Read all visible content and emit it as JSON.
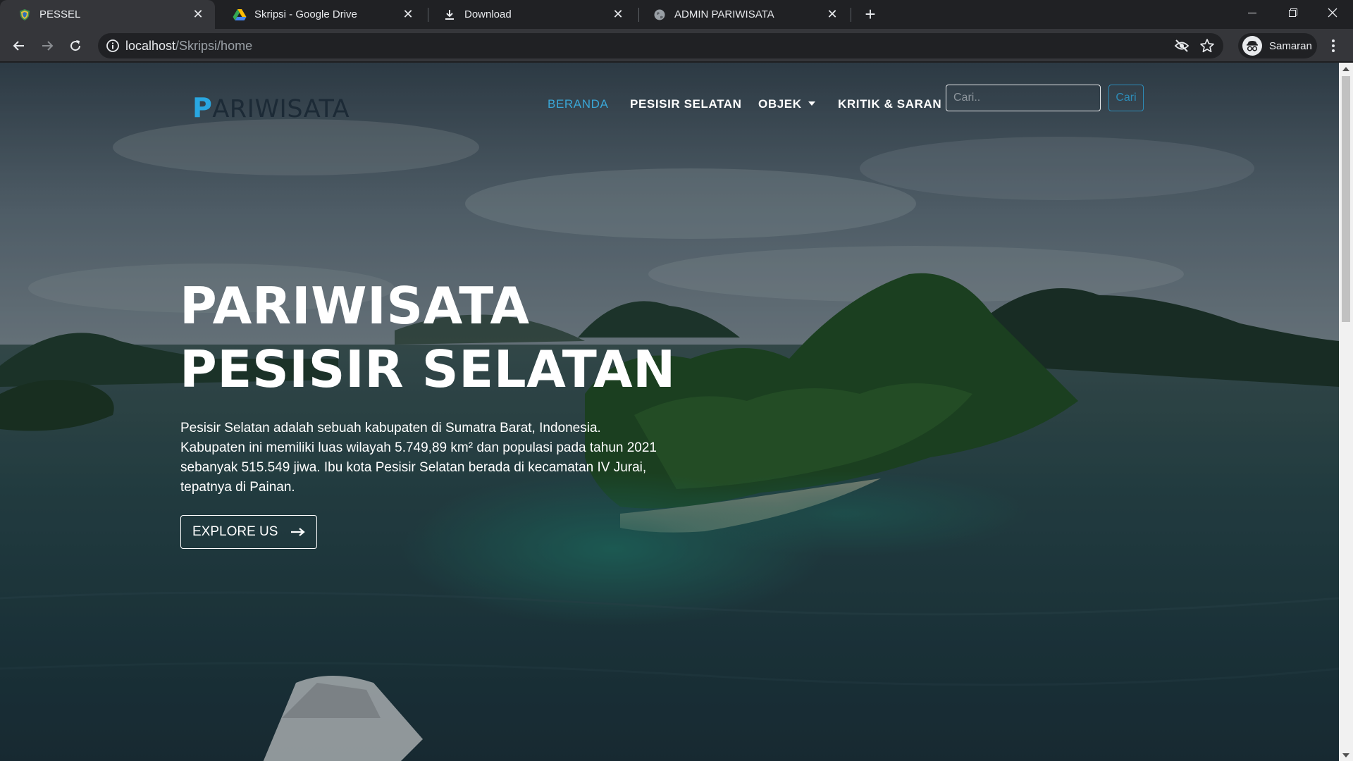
{
  "browser": {
    "tabs": [
      {
        "title": "PESSEL",
        "icon": "shield-icon",
        "active": true
      },
      {
        "title": "Skripsi - Google Drive",
        "icon": "google-drive-icon",
        "active": false
      },
      {
        "title": "Download",
        "icon": "download-icon",
        "active": false
      },
      {
        "title": "ADMIN PARIWISATA",
        "icon": "globe-icon",
        "active": false
      }
    ],
    "url_host": "localhost",
    "url_path": "/Skripsi/home",
    "profile_name": "Samaran"
  },
  "site": {
    "brand_initial": "P",
    "brand_rest": "ARIWISATA",
    "nav": [
      {
        "label": "BERANDA",
        "active": true
      },
      {
        "label": "PESISIR SELATAN",
        "active": false
      },
      {
        "label": "OBJEK",
        "active": false,
        "dropdown": true
      },
      {
        "label": "KRITIK & SARAN",
        "active": false
      }
    ],
    "search_placeholder": "Cari..",
    "search_button": "Cari",
    "accent_color": "#29a7e1"
  },
  "hero": {
    "title_line1": "PARIWISATA",
    "title_line2": "PESISIR SELATAN",
    "description": "Pesisir Selatan adalah sebuah kabupaten di Sumatra Barat, Indonesia. Kabupaten ini memiliki luas wilayah 5.749,89 km² dan populasi pada tahun 2021 sebanyak 515.549 jiwa. Ibu kota Pesisir Selatan berada di kecamatan IV Jurai, tepatnya di Painan.",
    "cta_label": "EXPLORE US"
  }
}
